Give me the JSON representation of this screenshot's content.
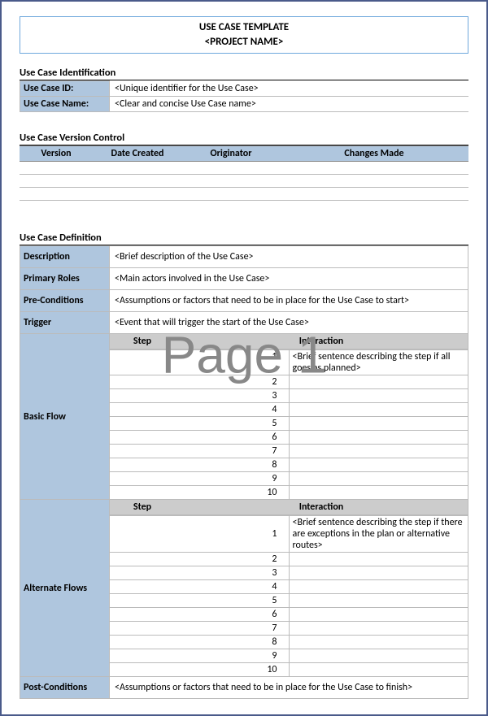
{
  "watermark": "Page 1",
  "title": {
    "line1": "USE CASE TEMPLATE",
    "line2": "<PROJECT NAME>"
  },
  "identification": {
    "heading": "Use Case Identification",
    "rows": [
      {
        "label": "Use Case ID:",
        "value": "<Unique identifier for the Use Case>"
      },
      {
        "label": "Use Case Name:",
        "value": "<Clear and concise Use Case name>"
      }
    ]
  },
  "version_control": {
    "heading": "Use Case Version Control",
    "columns": [
      "Version",
      "Date Created",
      "Originator",
      "Changes Made"
    ],
    "rows": [
      [
        "",
        "",
        "",
        ""
      ],
      [
        "",
        "",
        "",
        ""
      ],
      [
        "",
        "",
        "",
        ""
      ]
    ]
  },
  "definition": {
    "heading": "Use Case Definition",
    "description": {
      "label": "Description",
      "value": "<Brief description of the Use Case>"
    },
    "primary_roles": {
      "label": "Primary Roles",
      "value": "<Main actors involved in the Use Case>"
    },
    "pre_conditions": {
      "label": "Pre-Conditions",
      "value": "<Assumptions or factors that need to be in place for the Use Case to start>"
    },
    "trigger": {
      "label": "Trigger",
      "value": "<Event that will trigger the start of the Use Case>"
    },
    "basic_flow": {
      "label": "Basic Flow",
      "columns": [
        "Step",
        "Interaction"
      ],
      "steps": [
        {
          "n": "1",
          "text": "<Brief sentence describing the step if all goes as planned>"
        },
        {
          "n": "2",
          "text": ""
        },
        {
          "n": "3",
          "text": ""
        },
        {
          "n": "4",
          "text": ""
        },
        {
          "n": "5",
          "text": ""
        },
        {
          "n": "6",
          "text": ""
        },
        {
          "n": "7",
          "text": ""
        },
        {
          "n": "8",
          "text": ""
        },
        {
          "n": "9",
          "text": ""
        },
        {
          "n": "10",
          "text": ""
        }
      ]
    },
    "alternate_flows": {
      "label": "Alternate Flows",
      "columns": [
        "Step",
        "Interaction"
      ],
      "steps": [
        {
          "n": "1",
          "text": "<Brief sentence describing the step if there are exceptions in the plan or alternative routes>"
        },
        {
          "n": "2",
          "text": ""
        },
        {
          "n": "3",
          "text": ""
        },
        {
          "n": "4",
          "text": ""
        },
        {
          "n": "5",
          "text": ""
        },
        {
          "n": "6",
          "text": ""
        },
        {
          "n": "7",
          "text": ""
        },
        {
          "n": "8",
          "text": ""
        },
        {
          "n": "9",
          "text": ""
        },
        {
          "n": "10",
          "text": ""
        }
      ]
    },
    "post_conditions": {
      "label": "Post-Conditions",
      "value": "<Assumptions or factors that need to be in place for the Use Case to finish>"
    }
  }
}
